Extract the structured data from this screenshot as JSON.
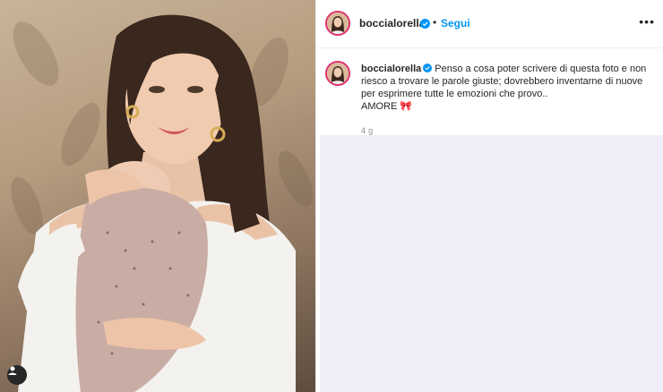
{
  "post": {
    "username": "boccialorella",
    "follow_label": "Segui",
    "separator": "•",
    "more_label": "•••",
    "caption": {
      "username": "boccialorella",
      "line1": "Penso a cosa poter scrivere di questa foto e non",
      "line2": "riesco a trovare le parole giuste; dovrebbero inventarne di nuove",
      "line3": "per esprimere tutte le emozioni che provo..",
      "line4": "AMORE",
      "emoji": "🎀"
    },
    "timestamp": "4 g"
  },
  "colors": {
    "accent": "#0095f6",
    "text": "#262626",
    "muted": "#8e8e8e",
    "empty_area": "#efeef8",
    "story_ring": "#e1306c"
  },
  "icons": {
    "verified": "verified-badge-icon",
    "more": "more-options-icon",
    "user_tag": "user-tag-icon"
  }
}
